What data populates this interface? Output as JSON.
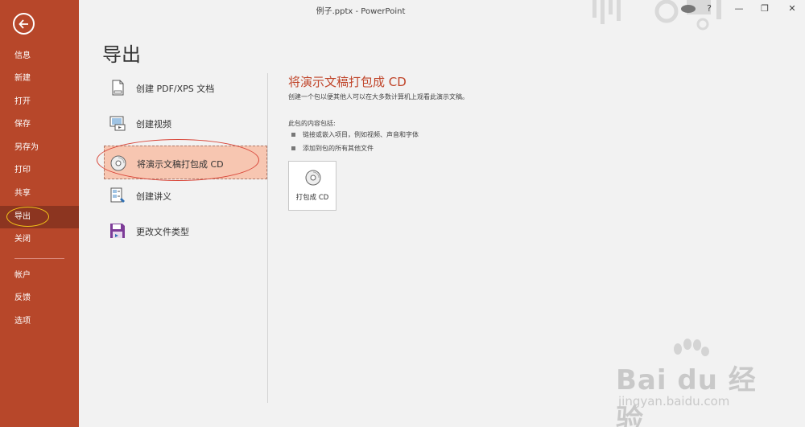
{
  "window": {
    "title": "例子.pptx  -  PowerPoint",
    "help": "?",
    "minimize": "—",
    "maximize": "❐",
    "close": "✕"
  },
  "sidebar": {
    "items": [
      {
        "label": "信息"
      },
      {
        "label": "新建"
      },
      {
        "label": "打开"
      },
      {
        "label": "保存"
      },
      {
        "label": "另存为"
      },
      {
        "label": "打印"
      },
      {
        "label": "共享"
      },
      {
        "label": "导出",
        "active": true
      },
      {
        "label": "关闭"
      },
      {
        "label": "帐户"
      },
      {
        "label": "反馈"
      },
      {
        "label": "选项"
      }
    ]
  },
  "page": {
    "title": "导出"
  },
  "options": [
    {
      "label": "创建 PDF/XPS 文档",
      "icon": "pdf-document-icon"
    },
    {
      "label": "创建视频",
      "icon": "video-icon"
    },
    {
      "label": "将演示文稿打包成 CD",
      "icon": "cd-icon",
      "selected": true
    },
    {
      "label": "创建讲义",
      "icon": "handout-icon"
    },
    {
      "label": "更改文件类型",
      "icon": "file-type-icon"
    }
  ],
  "detail": {
    "title": "将演示文稿打包成 CD",
    "description": "创建一个包以便其他人可以在大多数计算机上观看此演示文稿。",
    "contents_header": "此包的内容包括:",
    "bullets": [
      "链接或嵌入项目，例如视频、声音和字体",
      "添加到包的所有其他文件"
    ],
    "button_label": "打包成 CD"
  },
  "watermark": {
    "main": "Bai du 经验",
    "url": "jingyan.baidu.com"
  },
  "colors": {
    "sidebar": "#b7472a",
    "sidebar_active": "#8c3520",
    "accent_text": "#c0452a",
    "selection": "#f7c6b1"
  }
}
